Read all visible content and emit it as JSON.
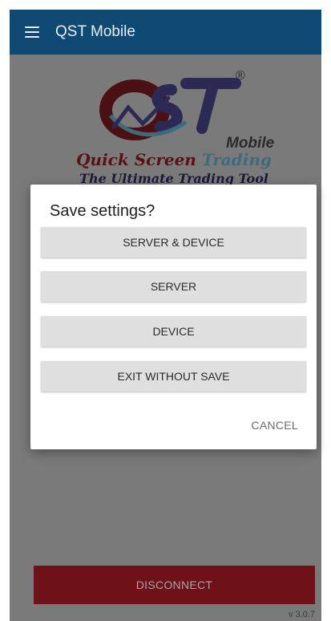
{
  "appbar": {
    "title": "QST Mobile"
  },
  "logo": {
    "mobile_word": "Mobile",
    "tagline_quick": "Quick",
    "tagline_screen": "Screen",
    "tagline_trading": "Trading",
    "tagline_sub": "The Ultimate Trading Tool",
    "registered": "®"
  },
  "dialog": {
    "title": "Save settings?",
    "options": [
      {
        "label": "SERVER & DEVICE"
      },
      {
        "label": "SERVER"
      },
      {
        "label": "DEVICE"
      },
      {
        "label": "EXIT WITHOUT SAVE"
      }
    ],
    "cancel_label": "CANCEL"
  },
  "footer": {
    "disconnect_label": "DISCONNECT",
    "version": "v 3.0.7"
  },
  "colors": {
    "appbar": "#0e4a73",
    "disconnect": "#6e1218",
    "overlay": "#7a7a7a"
  }
}
